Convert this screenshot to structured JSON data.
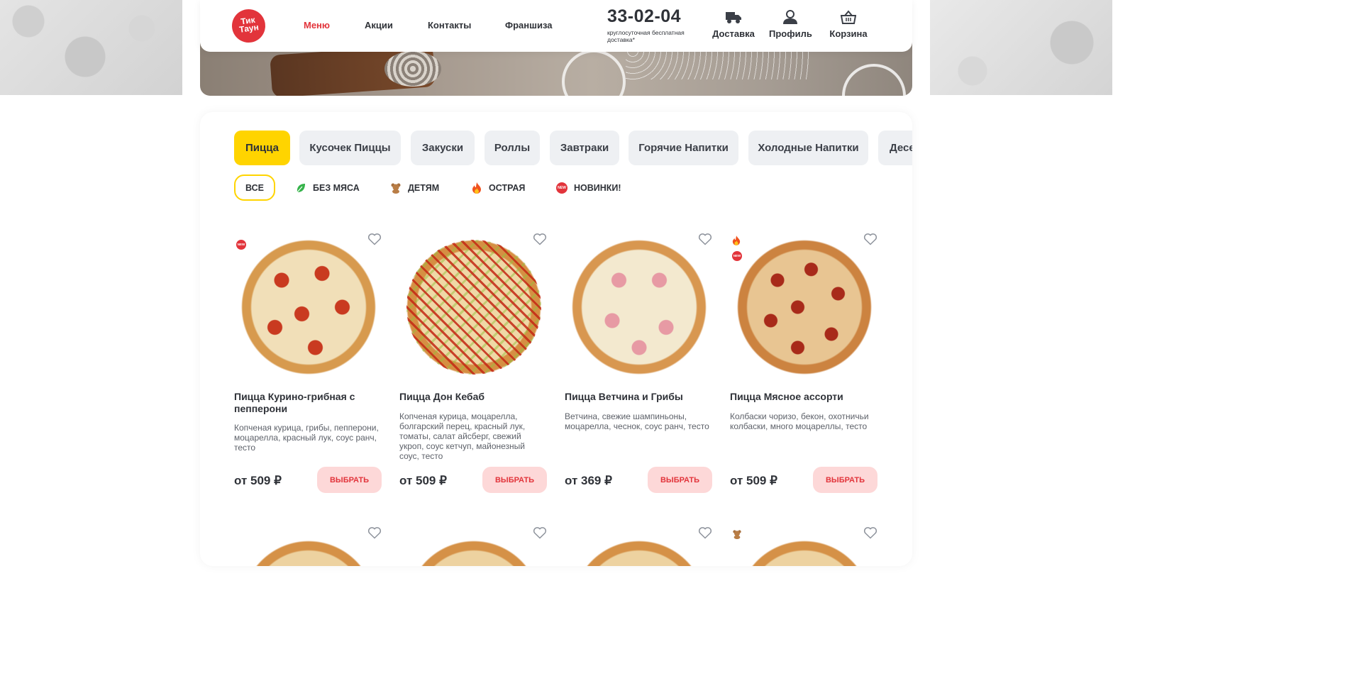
{
  "header": {
    "logo_text": "Тик Таун",
    "nav": [
      "Меню",
      "Акции",
      "Контакты",
      "Франшиза"
    ],
    "phone": "33-02-04",
    "phone_sub": "круглосуточная бесплатная доставка*",
    "icons": [
      {
        "label": "Доставка",
        "icon": "truck-icon"
      },
      {
        "label": "Профиль",
        "icon": "user-icon"
      },
      {
        "label": "Корзина",
        "icon": "basket-icon"
      }
    ]
  },
  "categories": [
    "Пицца",
    "Кусочек Пиццы",
    "Закуски",
    "Роллы",
    "Завтраки",
    "Горячие Напитки",
    "Холодные Напитки",
    "Десе"
  ],
  "filters": [
    "ВСЕ",
    "БЕЗ МЯСА",
    "ДЕТЯМ",
    "ОСТРАЯ",
    "НОВИНКИ!"
  ],
  "products": [
    {
      "title": "Пицца Курино-грибная с пепперони",
      "desc": "Копченая курица, грибы, пепперони, моцарелла, красный лук, соус ранч, тесто",
      "price": "от 509 ₽",
      "button": "ВЫБРАТЬ",
      "badges": [
        "new"
      ]
    },
    {
      "title": "Пицца Дон Кебаб",
      "desc": "Копченая курица, моцарелла, болгарский перец, красный лук, томаты, салат айсберг, свежий укроп, соус кетчуп, майонезный соус, тесто",
      "price": "от 509 ₽",
      "button": "ВЫБРАТЬ",
      "badges": []
    },
    {
      "title": "Пицца Ветчина и Грибы",
      "desc": "Ветчина, свежие шампиньоны, моцарелла, чеснок, соус ранч, тесто",
      "price": "от 369 ₽",
      "button": "ВЫБРАТЬ",
      "badges": []
    },
    {
      "title": "Пицца Мясное ассорти",
      "desc": "Колбаски чоризо, бекон, охотничьи колбаски, много моцареллы, тесто",
      "price": "от 509 ₽",
      "button": "ВЫБРАТЬ",
      "badges": [
        "spicy",
        "new"
      ]
    }
  ],
  "badge_text": {
    "new": "NEW"
  },
  "colors": {
    "accent": "#e2343b",
    "category_active": "#ffd400",
    "button_bg": "#fdd8d8"
  }
}
